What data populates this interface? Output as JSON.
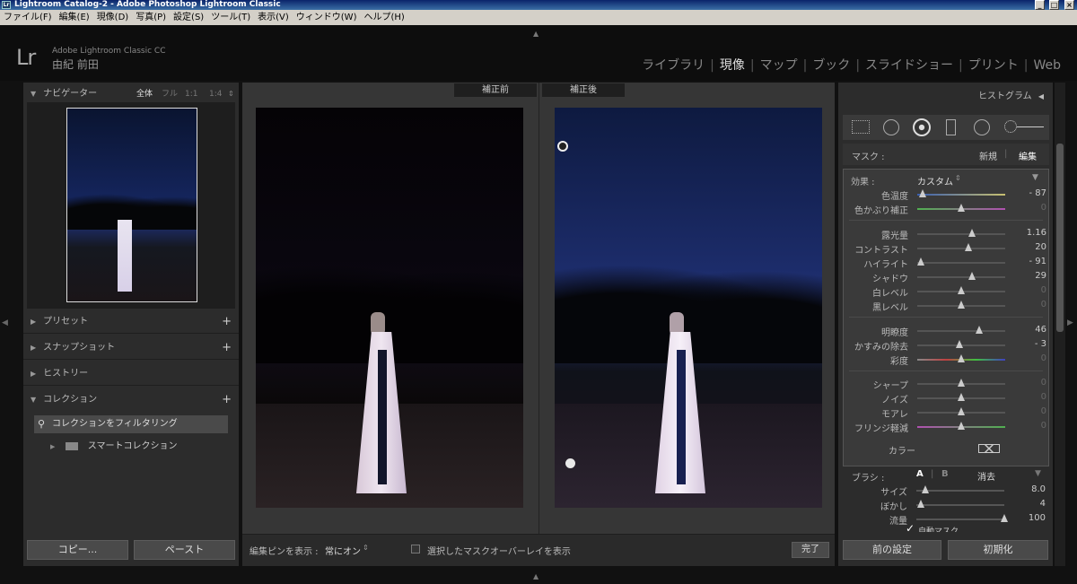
{
  "window": {
    "title": "Lightroom Catalog-2 - Adobe Photoshop Lightroom Classic",
    "icon_text": "Lr"
  },
  "menu": [
    "ファイル(F)",
    "編集(E)",
    "現像(D)",
    "写真(P)",
    "設定(S)",
    "ツール(T)",
    "表示(V)",
    "ウィンドウ(W)",
    "ヘルプ(H)"
  ],
  "identity": {
    "logo": "Lr",
    "app_name": "Adobe Lightroom Classic CC",
    "user_name": "由紀 前田"
  },
  "modules": [
    "ライブラリ",
    "現像",
    "マップ",
    "ブック",
    "スライドショー",
    "プリント",
    "Web"
  ],
  "active_module": "現像",
  "left_panel": {
    "navigator": {
      "title": "ナビゲーター",
      "zoom_options": [
        "全体",
        "フル",
        "1:1",
        "1:4"
      ],
      "active_zoom": "全体"
    },
    "sections": [
      "プリセット",
      "スナップショット",
      "ヒストリー",
      "コレクション"
    ],
    "collection_filter": "コレクションをフィルタリング",
    "smart_collection": "スマートコレクション",
    "copy_button": "コピー...",
    "paste_button": "ペースト"
  },
  "center": {
    "before_label": "補正前",
    "after_label": "補正後",
    "toolbar": {
      "show_pins_label": "編集ピンを表示 :",
      "show_pins_value": "常にオン",
      "overlay_label": "選択したマスクオーバーレイを表示",
      "done_button": "完了"
    }
  },
  "right_panel": {
    "histogram_title": "ヒストグラム",
    "mask_label": "マスク :",
    "mask_new": "新規",
    "mask_edit": "編集",
    "effect_label": "効果 :",
    "effect_value": "カスタム",
    "group1": [
      {
        "label": "色温度",
        "value": "- 87",
        "pos": 0.06
      },
      {
        "label": "色かぶり補正",
        "value": "0",
        "pos": 0.5
      }
    ],
    "group2": [
      {
        "label": "露光量",
        "value": "1.16",
        "pos": 0.62
      },
      {
        "label": "コントラスト",
        "value": "20",
        "pos": 0.58
      },
      {
        "label": "ハイライト",
        "value": "- 91",
        "pos": 0.04
      },
      {
        "label": "シャドウ",
        "value": "29",
        "pos": 0.62
      },
      {
        "label": "白レベル",
        "value": "0",
        "pos": 0.5
      },
      {
        "label": "黒レベル",
        "value": "0",
        "pos": 0.5
      }
    ],
    "group3": [
      {
        "label": "明瞭度",
        "value": "46",
        "pos": 0.7
      },
      {
        "label": "かすみの除去",
        "value": "- 3",
        "pos": 0.48
      },
      {
        "label": "彩度",
        "value": "0",
        "pos": 0.5
      }
    ],
    "group4": [
      {
        "label": "シャープ",
        "value": "0",
        "pos": 0.5
      },
      {
        "label": "ノイズ",
        "value": "0",
        "pos": 0.5
      },
      {
        "label": "モアレ",
        "value": "0",
        "pos": 0.5
      },
      {
        "label": "フリンジ軽減",
        "value": "0",
        "pos": 0.5
      }
    ],
    "color_label": "カラー",
    "brush": {
      "label": "ブラシ :",
      "a": "A",
      "b": "B",
      "erase": "消去",
      "rows": [
        {
          "label": "サイズ",
          "value": "8.0",
          "pos": 0.1
        },
        {
          "label": "ぼかし",
          "value": "4",
          "pos": 0.05
        },
        {
          "label": "流量",
          "value": "100",
          "pos": 1.0
        }
      ],
      "automask": "自動マスク"
    },
    "prev_button": "前の設定",
    "reset_button": "初期化"
  }
}
